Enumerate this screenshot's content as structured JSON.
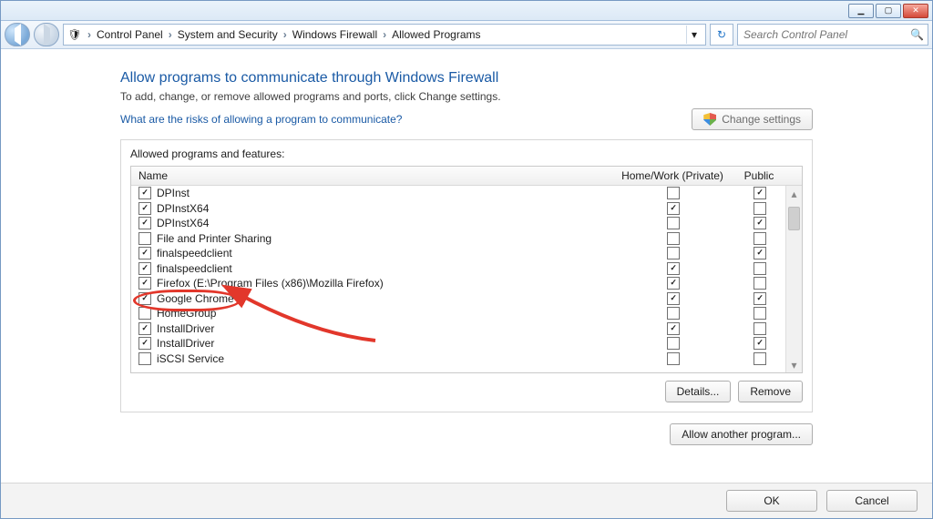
{
  "titlebar": {
    "min": "▁",
    "max": "▢",
    "close": "✕"
  },
  "breadcrumb": {
    "icon": "🛡",
    "items": [
      "Control Panel",
      "System and Security",
      "Windows Firewall",
      "Allowed Programs"
    ]
  },
  "search": {
    "placeholder": "Search Control Panel"
  },
  "page": {
    "title": "Allow programs to communicate through Windows Firewall",
    "subtitle": "To add, change, or remove allowed programs and ports, click Change settings.",
    "risks_link": "What are the risks of allowing a program to communicate?",
    "change_settings": "Change settings",
    "group_label": "Allowed programs and features:",
    "cols": {
      "name": "Name",
      "homework": "Home/Work (Private)",
      "public": "Public"
    },
    "rows": [
      {
        "enabled": true,
        "name": "DPInst",
        "hw": false,
        "pub": true
      },
      {
        "enabled": true,
        "name": "DPInstX64",
        "hw": true,
        "pub": false
      },
      {
        "enabled": true,
        "name": "DPInstX64",
        "hw": false,
        "pub": true
      },
      {
        "enabled": false,
        "name": "File and Printer Sharing",
        "hw": false,
        "pub": false
      },
      {
        "enabled": true,
        "name": "finalspeedclient",
        "hw": false,
        "pub": true
      },
      {
        "enabled": true,
        "name": "finalspeedclient",
        "hw": true,
        "pub": false
      },
      {
        "enabled": true,
        "name": "Firefox (E:\\Program Files (x86)\\Mozilla Firefox)",
        "hw": true,
        "pub": false
      },
      {
        "enabled": true,
        "name": "Google Chrome",
        "hw": true,
        "pub": true,
        "highlight": true
      },
      {
        "enabled": false,
        "name": "HomeGroup",
        "hw": false,
        "pub": false
      },
      {
        "enabled": true,
        "name": "InstallDriver",
        "hw": true,
        "pub": false
      },
      {
        "enabled": true,
        "name": "InstallDriver",
        "hw": false,
        "pub": true
      },
      {
        "enabled": false,
        "name": "iSCSI Service",
        "hw": false,
        "pub": false
      }
    ],
    "details": "Details...",
    "remove": "Remove",
    "allow_another": "Allow another program...",
    "ok": "OK",
    "cancel": "Cancel"
  }
}
